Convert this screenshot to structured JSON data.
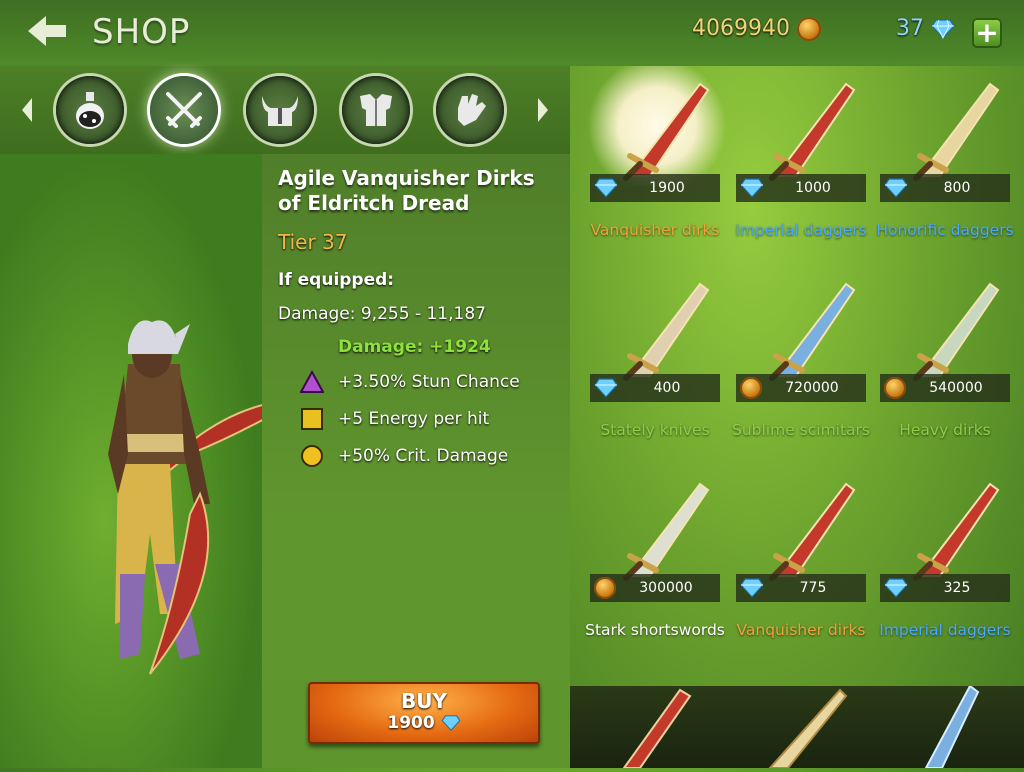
{
  "header": {
    "title": "SHOP",
    "gold": "4069940",
    "gems": "37",
    "plus_label": "+"
  },
  "categories": [
    {
      "name": "potions"
    },
    {
      "name": "weapons"
    },
    {
      "name": "helmets"
    },
    {
      "name": "armor"
    },
    {
      "name": "gloves"
    }
  ],
  "detail": {
    "name": "Agile Vanquisher Dirks of Eldritch Dread",
    "tier": "Tier 37",
    "equipped_label": "If equipped:",
    "damage": "Damage: 9,255 - 11,187",
    "damage_bonus": "Damage: +1924",
    "stats": [
      {
        "text": "+3.50% Stun Chance",
        "icon": "triangle-gem-icon"
      },
      {
        "text": "+5 Energy per hit",
        "icon": "square-gem-icon"
      },
      {
        "text": "+50% Crit. Damage",
        "icon": "circle-gem-icon"
      }
    ]
  },
  "buy": {
    "label": "BUY",
    "price": "1900",
    "currency": "gem"
  },
  "items": [
    {
      "name": "Vanquisher dirks",
      "price": "1900",
      "currency": "gem",
      "color": "#f0a13a",
      "selected": true
    },
    {
      "name": "Imperial daggers",
      "price": "1000",
      "currency": "gem",
      "color": "#4aa8ff"
    },
    {
      "name": "Honorific daggers",
      "price": "800",
      "currency": "gem",
      "color": "#4aa8ff"
    },
    {
      "name": "Stately knives",
      "price": "400",
      "currency": "gem",
      "color": "#8fcc4a"
    },
    {
      "name": "Sublime scimitars",
      "price": "720000",
      "currency": "gold",
      "color": "#8fcc4a"
    },
    {
      "name": "Heavy dirks",
      "price": "540000",
      "currency": "gold",
      "color": "#8fcc4a"
    },
    {
      "name": "Stark shortswords",
      "price": "300000",
      "currency": "gold",
      "color": "#ffffff"
    },
    {
      "name": "Vanquisher dirks",
      "price": "775",
      "currency": "gem",
      "color": "#f0a13a"
    },
    {
      "name": "Imperial daggers",
      "price": "325",
      "currency": "gem",
      "color": "#4aa8ff"
    }
  ]
}
